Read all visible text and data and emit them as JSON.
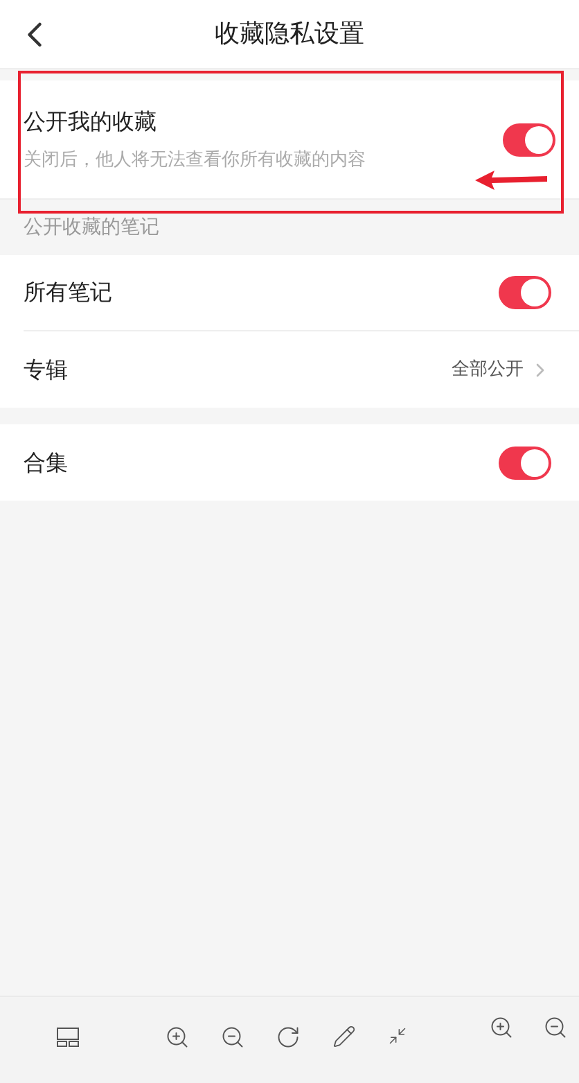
{
  "header": {
    "title": "收藏隐私设置"
  },
  "main_setting": {
    "label": "公开我的收藏",
    "description": "关闭后，他人将无法查看你所有收藏的内容",
    "on": true
  },
  "section_label": "公开收藏的笔记",
  "groups": [
    [
      {
        "kind": "toggle",
        "label": "所有笔记",
        "on": true
      },
      {
        "kind": "link",
        "label": "专辑",
        "value": "全部公开"
      }
    ],
    [
      {
        "kind": "toggle",
        "label": "合集",
        "on": true
      }
    ]
  ]
}
